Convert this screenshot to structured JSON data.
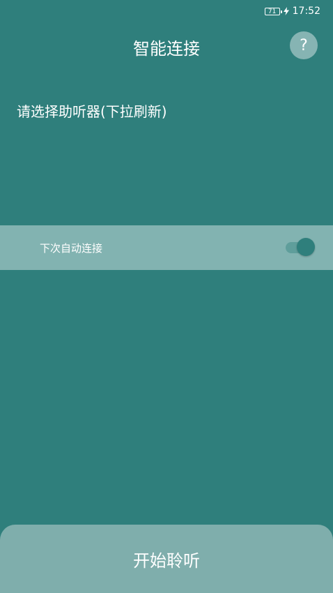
{
  "status_bar": {
    "battery": "71",
    "time": "17:52"
  },
  "header": {
    "title": "智能连接",
    "help_label": "?"
  },
  "prompt": "请选择助听器(下拉刷新)",
  "auto_connect": {
    "label": "下次自动连接",
    "enabled": true
  },
  "start_button": {
    "label": "开始聆听"
  },
  "colors": {
    "background": "#2f7f7c",
    "row_background": "#82b3b1",
    "button_background": "#7faeac"
  }
}
